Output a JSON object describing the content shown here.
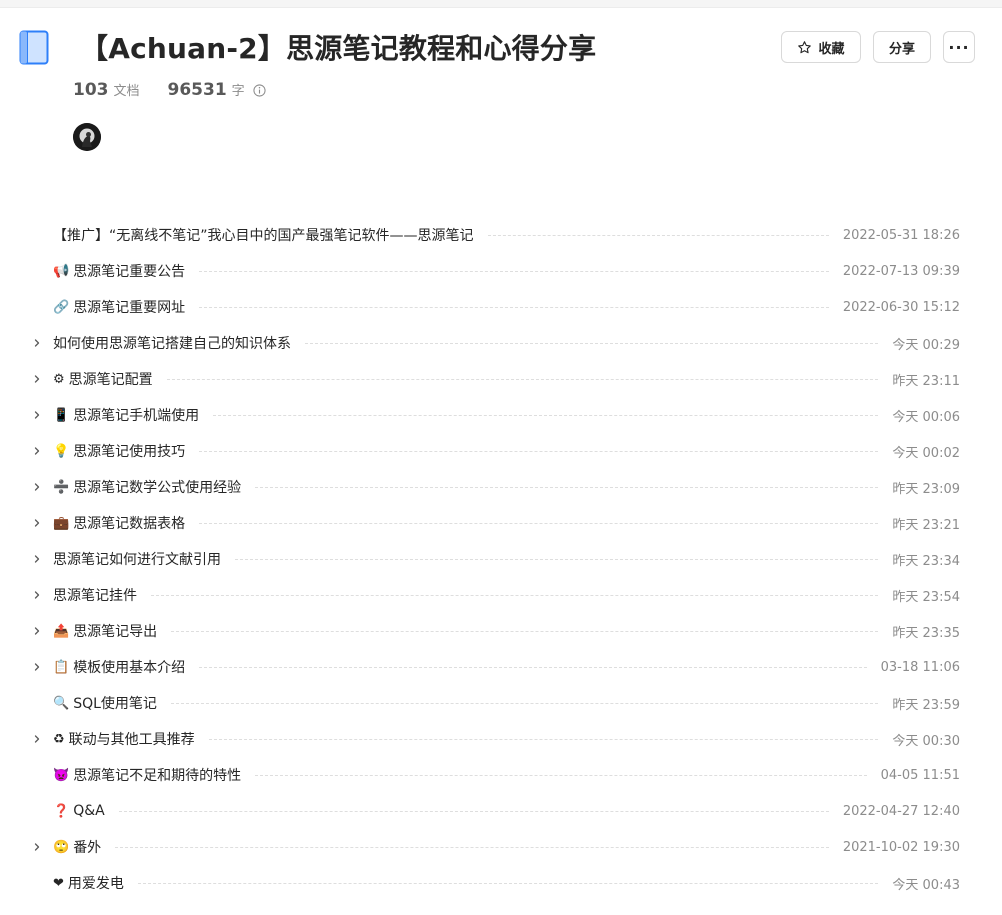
{
  "header": {
    "title": "【Achuan-2】思源笔记教程和心得分享",
    "favorite_label": "收藏",
    "share_label": "分享",
    "more_label": "···",
    "doc_count": "103",
    "doc_unit": "文档",
    "word_count": "96531",
    "word_unit": "字"
  },
  "items": [
    {
      "icon": "",
      "title": "【推广】“无离线不笔记”我心目中的国产最强笔记软件——思源笔记",
      "time": "2022-05-31 18:26",
      "expandable": false
    },
    {
      "icon": "📢",
      "title": "思源笔记重要公告",
      "time": "2022-07-13 09:39",
      "expandable": false
    },
    {
      "icon": "🔗",
      "title": "思源笔记重要网址",
      "time": "2022-06-30 15:12",
      "expandable": false
    },
    {
      "icon": "",
      "title": "如何使用思源笔记搭建自己的知识体系",
      "time": "今天 00:29",
      "expandable": true
    },
    {
      "icon": "⚙",
      "title": "思源笔记配置",
      "time": "昨天 23:11",
      "expandable": true
    },
    {
      "icon": "📱",
      "title": "思源笔记手机端使用",
      "time": "今天 00:06",
      "expandable": true
    },
    {
      "icon": "💡",
      "title": "思源笔记使用技巧",
      "time": "今天 00:02",
      "expandable": true
    },
    {
      "icon": "➗",
      "title": "思源笔记数学公式使用经验",
      "time": "昨天 23:09",
      "expandable": true
    },
    {
      "icon": "💼",
      "title": "思源笔记数据表格",
      "time": "昨天 23:21",
      "expandable": true
    },
    {
      "icon": "",
      "title": "思源笔记如何进行文献引用",
      "time": "昨天 23:34",
      "expandable": true
    },
    {
      "icon": "",
      "title": "思源笔记挂件",
      "time": "昨天 23:54",
      "expandable": true
    },
    {
      "icon": "📤",
      "title": "思源笔记导出",
      "time": "昨天 23:35",
      "expandable": true
    },
    {
      "icon": "📋",
      "title": "模板使用基本介绍",
      "time": "03-18 11:06",
      "expandable": true
    },
    {
      "icon": "🔍",
      "title": "SQL使用笔记",
      "time": "昨天 23:59",
      "expandable": false
    },
    {
      "icon": "♻",
      "title": "联动与其他工具推荐",
      "time": "今天 00:30",
      "expandable": true
    },
    {
      "icon": "👿",
      "title": "思源笔记不足和期待的特性",
      "time": "04-05 11:51",
      "expandable": false
    },
    {
      "icon": "❓",
      "title": "Q&A",
      "time": "2022-04-27 12:40",
      "expandable": false
    },
    {
      "icon": "🙄",
      "title": "番外",
      "time": "2021-10-02 19:30",
      "expandable": true
    },
    {
      "icon": "❤",
      "title": "用爱发电",
      "time": "今天 00:43",
      "expandable": false
    }
  ]
}
